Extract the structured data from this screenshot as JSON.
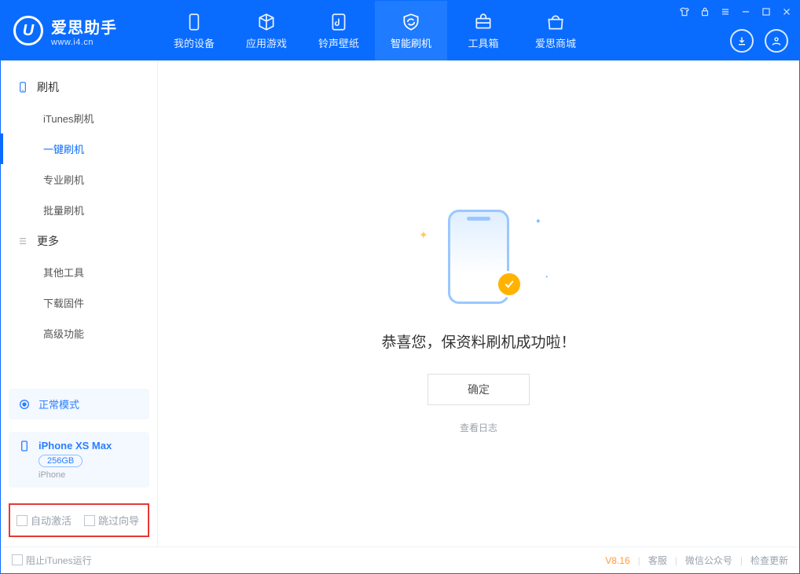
{
  "app": {
    "name_cn": "爱思助手",
    "name_en": "www.i4.cn"
  },
  "nav": {
    "tabs": [
      {
        "label": "我的设备"
      },
      {
        "label": "应用游戏"
      },
      {
        "label": "铃声壁纸"
      },
      {
        "label": "智能刷机"
      },
      {
        "label": "工具箱"
      },
      {
        "label": "爱思商城"
      }
    ],
    "active_index": 3
  },
  "sidebar": {
    "section1": {
      "title": "刷机",
      "items": [
        {
          "label": "iTunes刷机"
        },
        {
          "label": "一键刷机"
        },
        {
          "label": "专业刷机"
        },
        {
          "label": "批量刷机"
        }
      ],
      "active_index": 1
    },
    "section2": {
      "title": "更多",
      "items": [
        {
          "label": "其他工具"
        },
        {
          "label": "下载固件"
        },
        {
          "label": "高级功能"
        }
      ]
    },
    "mode_label": "正常模式",
    "device": {
      "name": "iPhone XS Max",
      "storage": "256GB",
      "subtype": "iPhone"
    },
    "checkbox1": "自动激活",
    "checkbox2": "跳过向导"
  },
  "main": {
    "message": "恭喜您，保资料刷机成功啦！",
    "ok_label": "确定",
    "log_link": "查看日志"
  },
  "footer": {
    "block_itunes": "阻止iTunes运行",
    "version": "V8.16",
    "link1": "客服",
    "link2": "微信公众号",
    "link3": "检查更新"
  }
}
